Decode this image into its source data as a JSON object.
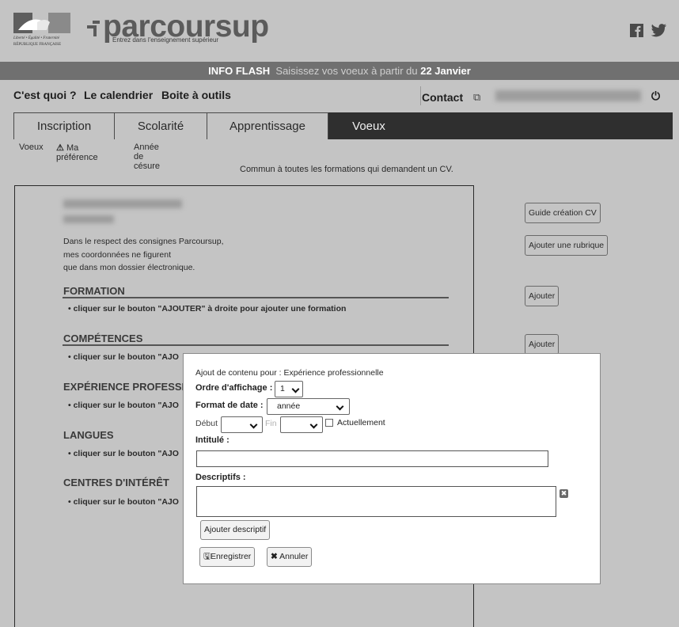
{
  "header": {
    "gov_logo_text": "Liberté • Égalité • Fraternité RÉPUBLIQUE FRANÇAISE",
    "logo": "parcoursup",
    "tagline": "Entrez dans l'enseignement supérieur",
    "social_icons": [
      "facebook-icon",
      "twitter-icon"
    ]
  },
  "flash": {
    "label": "INFO FLASH",
    "message": "Saisissez vos voeux à partir du",
    "date": "22 Janvier"
  },
  "topnav": {
    "items": [
      "C'est quoi ?",
      "Le calendrier",
      "Boite à outils"
    ],
    "contact": "Contact",
    "contact_icon": "copy-icon",
    "power_icon": "power-icon"
  },
  "tabs": [
    "Inscription",
    "Scolarité",
    "Apprentissage",
    "Voeux"
  ],
  "active_tab": "Voeux",
  "subnav": [
    "Voeux",
    "Ma préférence",
    "Année de césure"
  ],
  "common_note": "Commun à toutes les formations qui demandent un CV.",
  "cv": {
    "privacy_lines": [
      "Dans le respect des consignes Parcoursup,",
      "mes coordonnées ne figurent",
      "que dans mon dossier électronique."
    ],
    "sections": [
      {
        "title": "FORMATION",
        "item": "• cliquer sur le bouton \"AJOUTER\" à droite pour ajouter une formation"
      },
      {
        "title": "COMPÉTENCES",
        "item": "• cliquer sur le bouton \"AJO"
      },
      {
        "title": "EXPÉRIENCE PROFESSI",
        "item": "• cliquer sur le bouton \"AJO"
      },
      {
        "title": "LANGUES",
        "item": "• cliquer sur le bouton \"AJO"
      },
      {
        "title": "CENTRES D'INTÉRÊT",
        "item": "• cliquer sur le bouton \"AJO"
      }
    ]
  },
  "right_buttons": {
    "guide": "Guide création CV",
    "add_section": "Ajouter une rubrique",
    "add_1": "Ajouter",
    "add_2": "Ajouter"
  },
  "modal": {
    "heading": "Ajout de contenu pour : Expérience professionnelle",
    "order_label": "Ordre d'affichage :",
    "order_value": "1",
    "date_format_label": "Format de date :",
    "date_format_value": "année",
    "start_label": "Début",
    "end_label": "Fin",
    "current_label": "Actuellement",
    "current_checked": false,
    "title_label": "Intitulé :",
    "desc_label": "Descriptifs :",
    "add_desc_button": "Ajouter descriptif",
    "save_button": "Enregistrer",
    "cancel_button": "Annuler"
  }
}
